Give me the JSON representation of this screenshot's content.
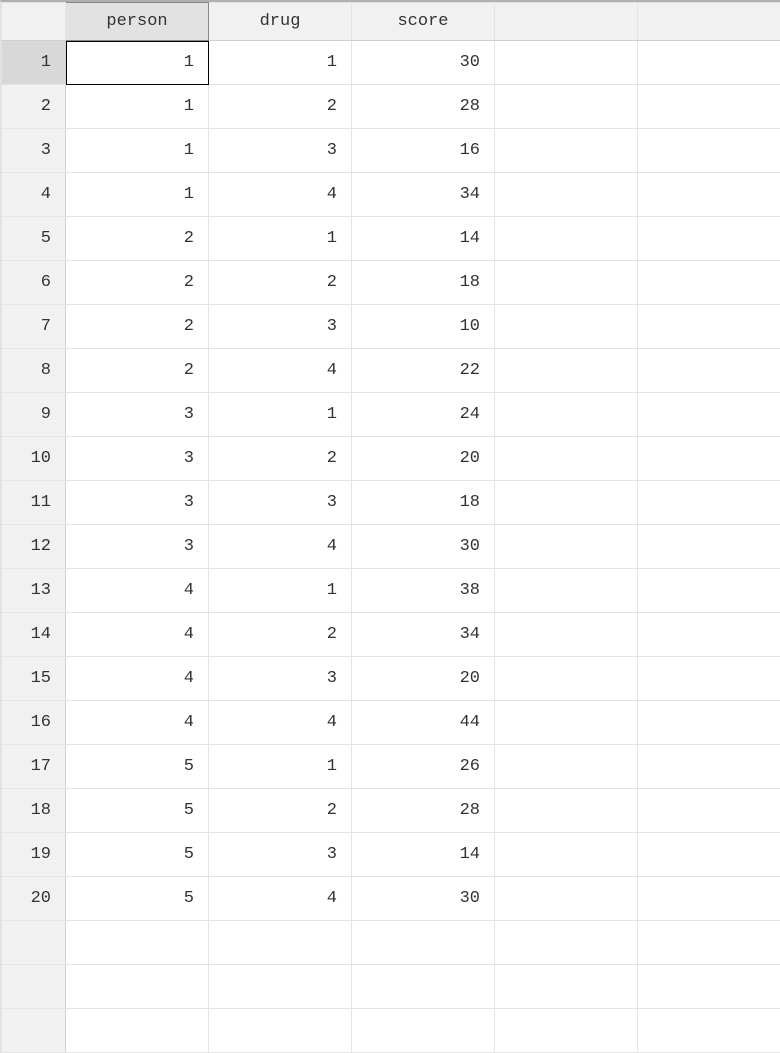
{
  "columns": [
    "person",
    "drug",
    "score"
  ],
  "extra_blank_columns": 2,
  "selected": {
    "row": 1,
    "col": 0
  },
  "rows": [
    {
      "n": 1,
      "cells": [
        "1",
        "1",
        "30"
      ]
    },
    {
      "n": 2,
      "cells": [
        "1",
        "2",
        "28"
      ]
    },
    {
      "n": 3,
      "cells": [
        "1",
        "3",
        "16"
      ]
    },
    {
      "n": 4,
      "cells": [
        "1",
        "4",
        "34"
      ]
    },
    {
      "n": 5,
      "cells": [
        "2",
        "1",
        "14"
      ]
    },
    {
      "n": 6,
      "cells": [
        "2",
        "2",
        "18"
      ]
    },
    {
      "n": 7,
      "cells": [
        "2",
        "3",
        "10"
      ]
    },
    {
      "n": 8,
      "cells": [
        "2",
        "4",
        "22"
      ]
    },
    {
      "n": 9,
      "cells": [
        "3",
        "1",
        "24"
      ]
    },
    {
      "n": 10,
      "cells": [
        "3",
        "2",
        "20"
      ]
    },
    {
      "n": 11,
      "cells": [
        "3",
        "3",
        "18"
      ]
    },
    {
      "n": 12,
      "cells": [
        "3",
        "4",
        "30"
      ]
    },
    {
      "n": 13,
      "cells": [
        "4",
        "1",
        "38"
      ]
    },
    {
      "n": 14,
      "cells": [
        "4",
        "2",
        "34"
      ]
    },
    {
      "n": 15,
      "cells": [
        "4",
        "3",
        "20"
      ]
    },
    {
      "n": 16,
      "cells": [
        "4",
        "4",
        "44"
      ]
    },
    {
      "n": 17,
      "cells": [
        "5",
        "1",
        "26"
      ]
    },
    {
      "n": 18,
      "cells": [
        "5",
        "2",
        "28"
      ]
    },
    {
      "n": 19,
      "cells": [
        "5",
        "3",
        "14"
      ]
    },
    {
      "n": 20,
      "cells": [
        "5",
        "4",
        "30"
      ]
    }
  ],
  "trailing_empty_rows": 3,
  "chart_data": {
    "type": "table",
    "columns": [
      "person",
      "drug",
      "score"
    ],
    "data": [
      [
        1,
        1,
        30
      ],
      [
        1,
        2,
        28
      ],
      [
        1,
        3,
        16
      ],
      [
        1,
        4,
        34
      ],
      [
        2,
        1,
        14
      ],
      [
        2,
        2,
        18
      ],
      [
        2,
        3,
        10
      ],
      [
        2,
        4,
        22
      ],
      [
        3,
        1,
        24
      ],
      [
        3,
        2,
        20
      ],
      [
        3,
        3,
        18
      ],
      [
        3,
        4,
        30
      ],
      [
        4,
        1,
        38
      ],
      [
        4,
        2,
        34
      ],
      [
        4,
        3,
        20
      ],
      [
        4,
        4,
        44
      ],
      [
        5,
        1,
        26
      ],
      [
        5,
        2,
        28
      ],
      [
        5,
        3,
        14
      ],
      [
        5,
        4,
        30
      ]
    ]
  }
}
